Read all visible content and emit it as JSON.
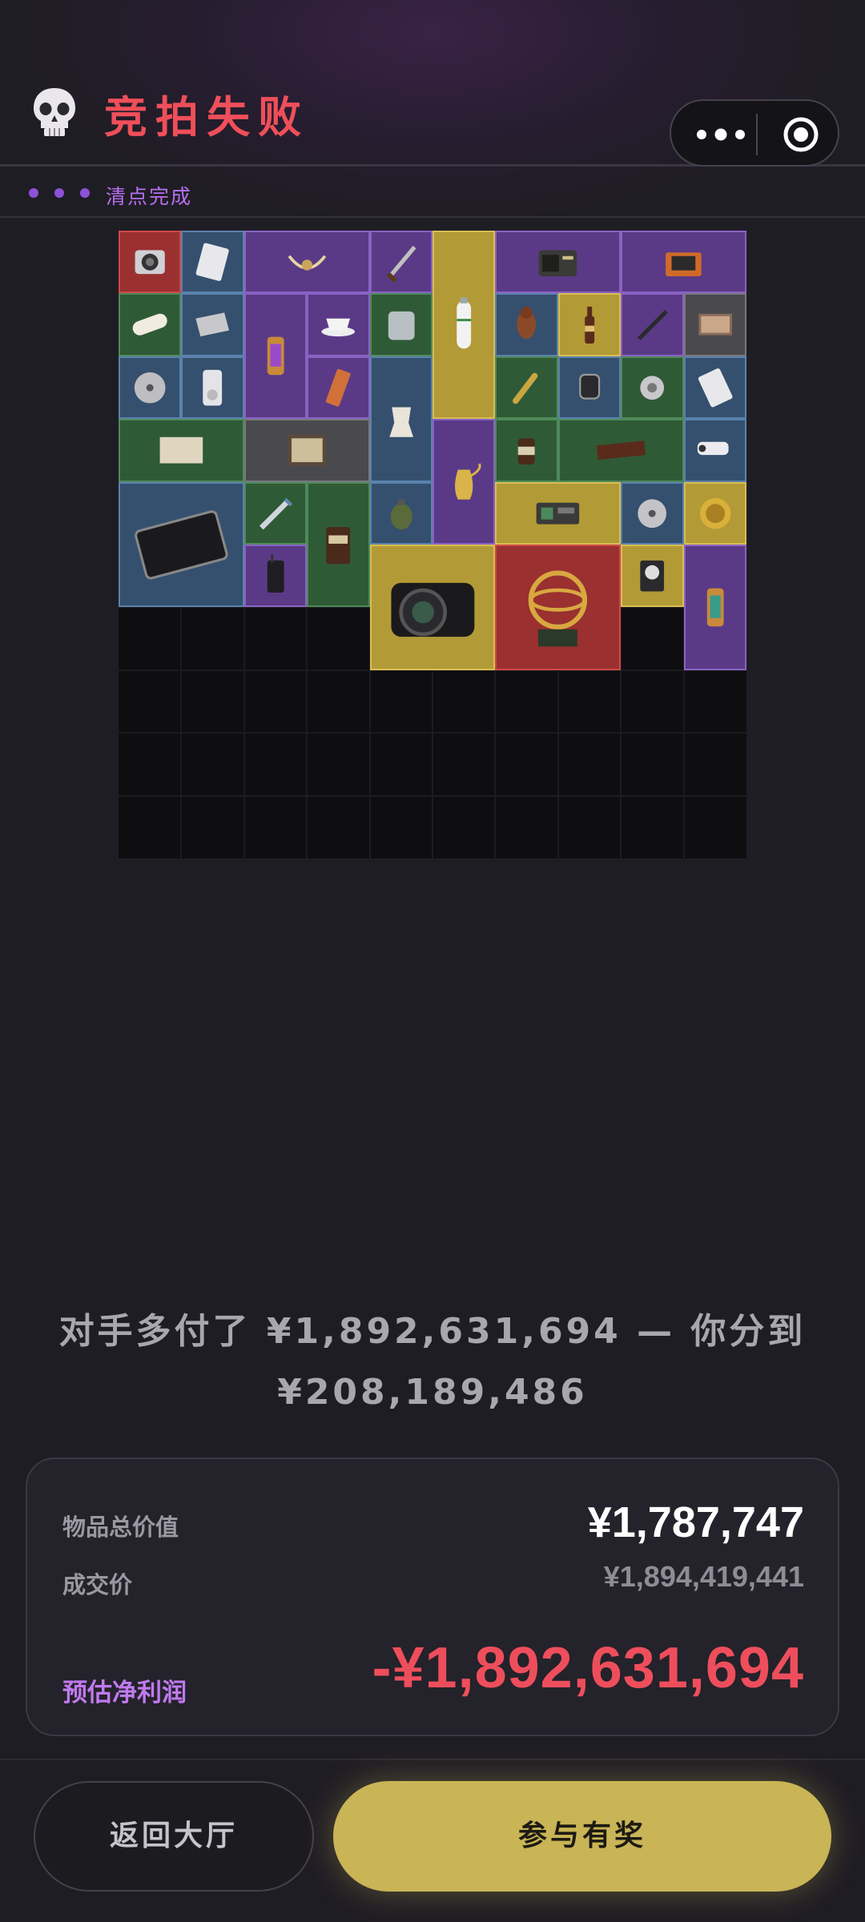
{
  "header": {
    "title": "竞拍失败",
    "icon": "skull-icon",
    "accent_color": "#ef4f5a"
  },
  "capsule": {
    "more_icon": "more-dots-icon",
    "close_icon": "target-circle-icon"
  },
  "status": {
    "text": "清点完成",
    "color": "#b66ff0"
  },
  "inventory": {
    "items": [
      {
        "name": "camera-module",
        "rarity": "red"
      },
      {
        "name": "data-card",
        "rarity": "blue"
      },
      {
        "name": "horned-skull",
        "rarity": "purple"
      },
      {
        "name": "dagger",
        "rarity": "purple"
      },
      {
        "name": "oxygen-tank",
        "rarity": "gold"
      },
      {
        "name": "radio",
        "rarity": "purple"
      },
      {
        "name": "toolbox",
        "rarity": "purple"
      },
      {
        "name": "bandage-roll",
        "rarity": "green"
      },
      {
        "name": "tray",
        "rarity": "blue"
      },
      {
        "name": "lantern",
        "rarity": "purple"
      },
      {
        "name": "teacup",
        "rarity": "purple"
      },
      {
        "name": "pouch",
        "rarity": "green"
      },
      {
        "name": "bird-figurine",
        "rarity": "blue"
      },
      {
        "name": "bottle",
        "rarity": "gold"
      },
      {
        "name": "pen",
        "rarity": "purple"
      },
      {
        "name": "matchbox",
        "rarity": "gray"
      },
      {
        "name": "disc",
        "rarity": "blue"
      },
      {
        "name": "mp3-player",
        "rarity": "blue"
      },
      {
        "name": "snack-bar",
        "rarity": "purple"
      },
      {
        "name": "moka-pot",
        "rarity": "blue"
      },
      {
        "name": "bullet",
        "rarity": "green"
      },
      {
        "name": "smartwatch",
        "rarity": "blue"
      },
      {
        "name": "gear-part",
        "rarity": "green"
      },
      {
        "name": "calculator",
        "rarity": "blue"
      },
      {
        "name": "old-map",
        "rarity": "green"
      },
      {
        "name": "framed-map",
        "rarity": "gray"
      },
      {
        "name": "ewer",
        "rarity": "purple"
      },
      {
        "name": "jar",
        "rarity": "green"
      },
      {
        "name": "wooden-plank",
        "rarity": "green"
      },
      {
        "name": "cctv-camera",
        "rarity": "blue"
      },
      {
        "name": "tablet",
        "rarity": "blue"
      },
      {
        "name": "syringe",
        "rarity": "green"
      },
      {
        "name": "coffee-bag",
        "rarity": "green"
      },
      {
        "name": "grenade",
        "rarity": "blue"
      },
      {
        "name": "circuit-board",
        "rarity": "gold"
      },
      {
        "name": "hard-drive",
        "rarity": "blue"
      },
      {
        "name": "medallion",
        "rarity": "gold"
      },
      {
        "name": "walkie-talkie",
        "rarity": "purple"
      },
      {
        "name": "dslr-camera",
        "rarity": "gold"
      },
      {
        "name": "armillary-sphere",
        "rarity": "red"
      },
      {
        "name": "gauge-meter",
        "rarity": "gold"
      },
      {
        "name": "lantern-2",
        "rarity": "purple"
      }
    ]
  },
  "message": {
    "line1": "对手多付了 ¥1,892,631,694 — 你分到",
    "line2": "¥208,189,486"
  },
  "summary": {
    "total_label": "物品总价值",
    "total_value": "¥1,787,747",
    "deal_label": "成交价",
    "deal_value": "¥1,894,419,441",
    "profit_label": "预估净利润",
    "profit_value": "-¥1,892,631,694",
    "profit_color": "#ee4e5c"
  },
  "buttons": {
    "back_label": "返回大厅",
    "join_label": "参与有奖",
    "join_color": "#c9b456"
  }
}
